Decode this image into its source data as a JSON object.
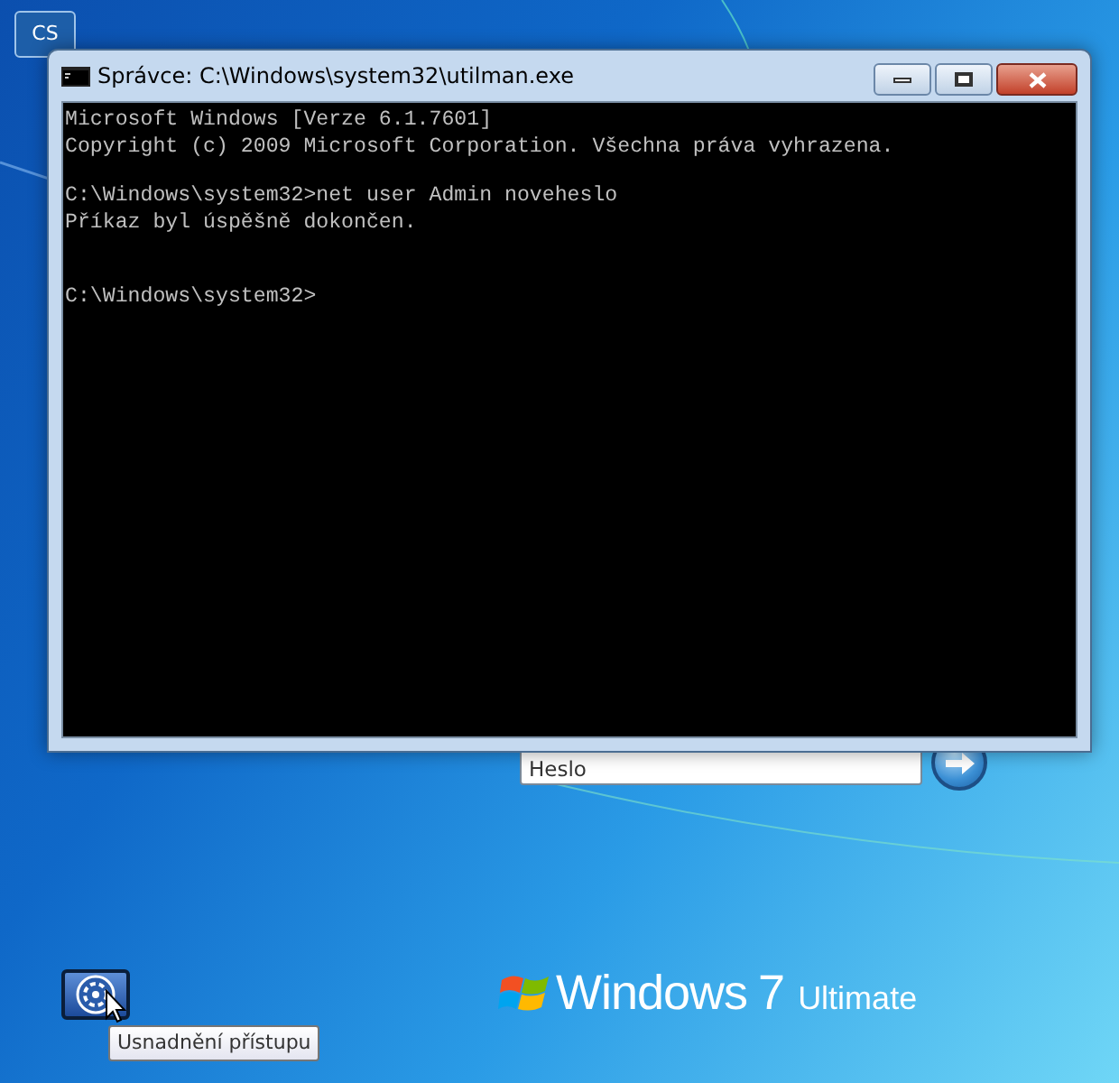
{
  "language_badge": "CS",
  "window": {
    "title": "Správce: C:\\Windows\\system32\\utilman.exe",
    "console": {
      "blocks": [
        [
          "Microsoft Windows [Verze 6.1.7601]",
          "Copyright (c) 2009 Microsoft Corporation. Všechna práva vyhrazena."
        ],
        [
          "C:\\Windows\\system32>net user Admin noveheslo",
          "Příkaz byl úspěšně dokončen."
        ],
        [
          "C:\\Windows\\system32>"
        ]
      ]
    }
  },
  "password": {
    "placeholder": "Heslo"
  },
  "brand": {
    "name": "Windows",
    "version": "7",
    "edition": "Ultimate"
  },
  "accessibility": {
    "tooltip": "Usnadnění přístupu"
  }
}
